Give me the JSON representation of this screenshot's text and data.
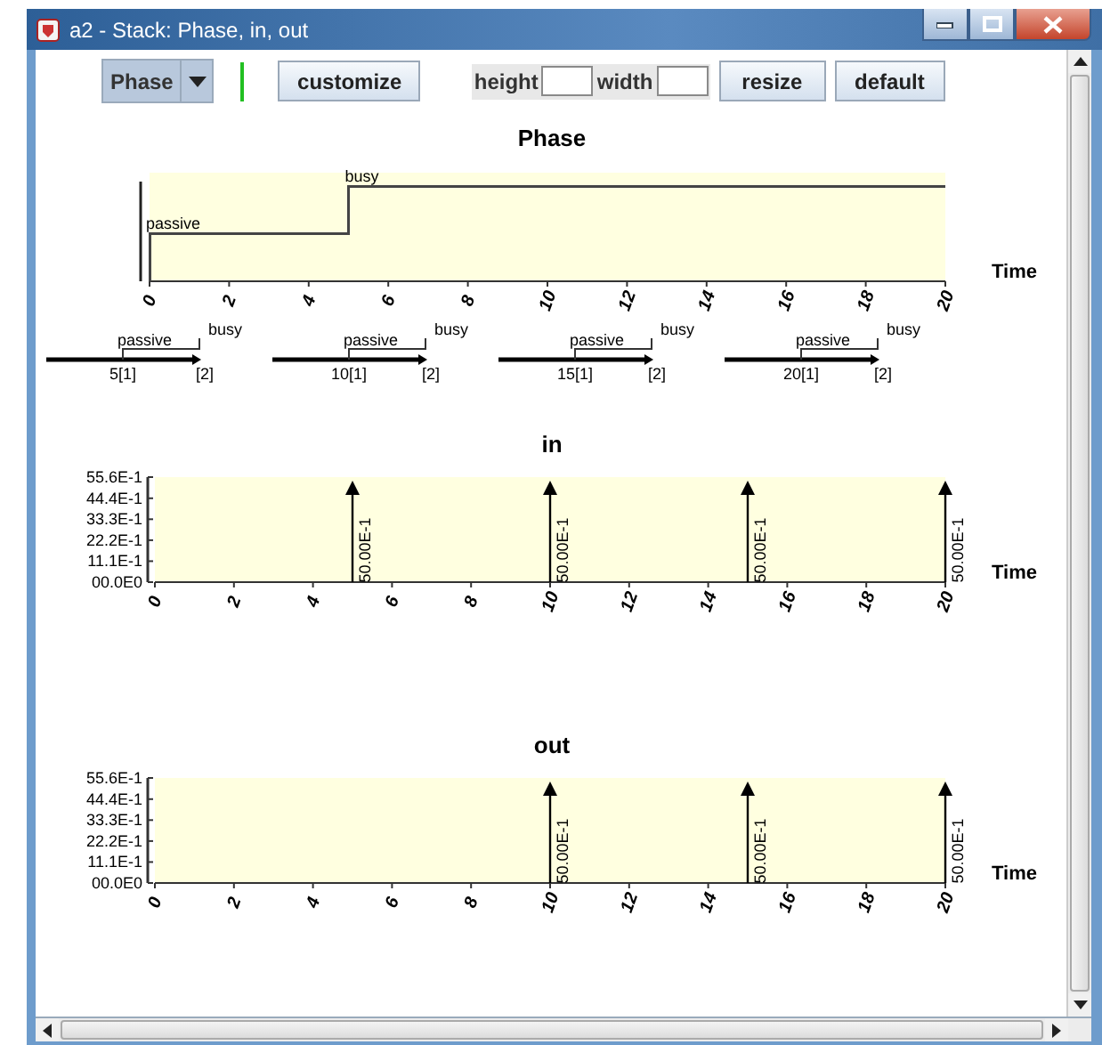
{
  "window": {
    "title": "a2 - Stack: Phase, in, out"
  },
  "toolbar": {
    "dropdown": "Phase",
    "customize": "customize",
    "height_label": "height",
    "width_label": "width",
    "resize": "resize",
    "default": "default"
  },
  "charts": [
    {
      "kind": "phase",
      "title": "Phase",
      "xlabel": "Time",
      "tick_labels": [
        "0",
        "2",
        "4",
        "6",
        "8",
        "10",
        "12",
        "14",
        "16",
        "18",
        "20"
      ],
      "states": [
        "passive",
        "busy"
      ],
      "transitions": [
        {
          "time": "5[1]",
          "next": "[2]",
          "from": "passive",
          "to": "busy"
        },
        {
          "time": "10[1]",
          "next": "[2]",
          "from": "passive",
          "to": "busy"
        },
        {
          "time": "15[1]",
          "next": "[2]",
          "from": "passive",
          "to": "busy"
        },
        {
          "time": "20[1]",
          "next": "[2]",
          "from": "passive",
          "to": "busy"
        }
      ]
    },
    {
      "kind": "impulse",
      "chart_data": {
        "type": "scatter",
        "title": "in",
        "xlabel": "Time",
        "x": [
          5,
          10,
          15,
          20
        ],
        "values": [
          5,
          5,
          5,
          5
        ],
        "xlim": [
          0,
          20
        ],
        "ylim": [
          0,
          5.56
        ],
        "xticks": [
          0,
          2,
          4,
          6,
          8,
          10,
          12,
          14,
          16,
          18,
          20
        ],
        "yticks": [
          {
            "value": 0,
            "label": "00.0E0"
          },
          {
            "value": 1.11,
            "label": "11.1E-1"
          },
          {
            "value": 2.22,
            "label": "22.2E-1"
          },
          {
            "value": 3.33,
            "label": "33.3E-1"
          },
          {
            "value": 4.44,
            "label": "44.4E-1"
          },
          {
            "value": 5.56,
            "label": "55.6E-1"
          }
        ],
        "value_labels": [
          "50.00E-1",
          "50.00E-1",
          "50.00E-1",
          "50.00E-1"
        ]
      }
    },
    {
      "kind": "impulse",
      "chart_data": {
        "type": "scatter",
        "title": "out",
        "xlabel": "Time",
        "x": [
          10,
          15,
          20
        ],
        "values": [
          5,
          5,
          5
        ],
        "xlim": [
          0,
          20
        ],
        "ylim": [
          0,
          5.56
        ],
        "xticks": [
          0,
          2,
          4,
          6,
          8,
          10,
          12,
          14,
          16,
          18,
          20
        ],
        "yticks": [
          {
            "value": 0,
            "label": "00.0E0"
          },
          {
            "value": 1.11,
            "label": "11.1E-1"
          },
          {
            "value": 2.22,
            "label": "22.2E-1"
          },
          {
            "value": 3.33,
            "label": "33.3E-1"
          },
          {
            "value": 4.44,
            "label": "44.4E-1"
          },
          {
            "value": 5.56,
            "label": "55.6E-1"
          }
        ],
        "value_labels": [
          "50.00E-1",
          "50.00E-1",
          "50.00E-1"
        ]
      }
    }
  ]
}
